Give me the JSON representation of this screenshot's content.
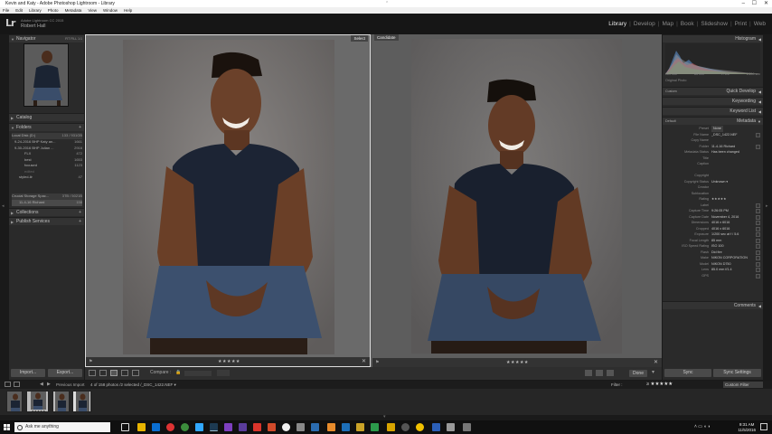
{
  "window": {
    "title": "Kevin and Katy - Adobe Photoshop Lightroom - Library"
  },
  "menu": [
    "File",
    "Edit",
    "Library",
    "Photo",
    "Metadata",
    "View",
    "Window",
    "Help"
  ],
  "identity": {
    "logo": "Lr",
    "version": "Adobe Lightroom CC 2015",
    "user": "Robert Hall"
  },
  "modules": [
    {
      "label": "Library",
      "active": true
    },
    {
      "label": "Develop"
    },
    {
      "label": "Map"
    },
    {
      "label": "Book"
    },
    {
      "label": "Slideshow"
    },
    {
      "label": "Print"
    },
    {
      "label": "Web"
    }
  ],
  "left": {
    "navigator": {
      "title": "Navigator",
      "zoom": "FIT  FILL  1:1"
    },
    "catalog": "Catalog",
    "folders": "Folders",
    "volume1": {
      "name": "Local Disk (D:)",
      "info": "133 / 931GB"
    },
    "folder_rows": [
      {
        "name": "9-24-2016 BHP Katy an...",
        "count": "1661"
      },
      {
        "name": "9-30-2016 BHP Julian ...",
        "count": "2916"
      },
      {
        "name": "FLX",
        "count": "472"
      },
      {
        "name": "best",
        "count": "1653"
      },
      {
        "name": "focused",
        "count": "1123"
      },
      {
        "name": "edited",
        "count": ""
      },
      {
        "name": "styled-ilr",
        "count": "47"
      }
    ],
    "volume2": {
      "name": "Crucial Storage Spac...",
      "info": "3TB / 5021B"
    },
    "volume2_rows": [
      {
        "name": "11-4-16 Richard",
        "count": "158"
      }
    ],
    "collections": "Collections",
    "publish": "Publish Services",
    "import_label": "Import...",
    "export_label": "Export..."
  },
  "center": {
    "select_tag": "Select",
    "candidate_tag": "Candidate",
    "rating": "★★★★★",
    "compare_label": "Compare :",
    "done_label": "Done"
  },
  "right": {
    "histogram": "Histogram",
    "hist_meta": [
      "ISO 100",
      "85 mm",
      "f / 5.6",
      "1/200 sec"
    ],
    "original_photo": "Original Photo",
    "quick_develop": "Quick Develop",
    "custom_preset": "Custom",
    "keywording": "Keywording",
    "keyword_list": "Keyword List",
    "metadata": "Metadata",
    "default_preset": "Default",
    "rows": [
      {
        "k": "Preset",
        "v": "None",
        "field": true
      },
      {
        "k": "File Name",
        "v": "_DSC_1422.NEF",
        "chk": true
      },
      {
        "k": "Copy Name",
        "v": ""
      },
      {
        "k": "Folder",
        "v": "11-4-16 Richard",
        "chk": true
      },
      {
        "k": "Metadata Status",
        "v": "Has been changed"
      },
      {
        "k": "Title",
        "v": ""
      },
      {
        "k": "Caption",
        "v": ""
      },
      {
        "k": "",
        "v": ""
      },
      {
        "k": "Copyright",
        "v": ""
      },
      {
        "k": "Copyright Status",
        "v": "Unknown ▾"
      },
      {
        "k": "Creator",
        "v": ""
      },
      {
        "k": "Sublocation",
        "v": ""
      },
      {
        "k": "Rating",
        "v": "★★★★★"
      },
      {
        "k": "Label",
        "v": "",
        "chk": true
      },
      {
        "k": "Capture Time",
        "v": "9:26:05 PM",
        "chk": true
      },
      {
        "k": "Capture Date",
        "v": "November 4, 2016",
        "chk": true
      },
      {
        "k": "Dimensions",
        "v": "4016 x 6016",
        "chk": true
      },
      {
        "k": "Cropped",
        "v": "4016 x 6016",
        "chk": true
      },
      {
        "k": "Exposure",
        "v": "1/200 sec at f / 5.6",
        "chk": true
      },
      {
        "k": "Focal Length",
        "v": "85 mm",
        "chk": true
      },
      {
        "k": "ISO Speed Rating",
        "v": "ISO 100",
        "chk": true
      },
      {
        "k": "Flash",
        "v": "Did fire",
        "chk": true
      },
      {
        "k": "Make",
        "v": "NIKON CORPORATION",
        "chk": true
      },
      {
        "k": "Model",
        "v": "NIKON D750",
        "chk": true
      },
      {
        "k": "Lens",
        "v": "85.0 mm f/1.4",
        "chk": true
      },
      {
        "k": "GPS",
        "v": "",
        "chk": true
      }
    ],
    "comments": "Comments",
    "sync_label": "Sync",
    "sync_settings_label": "Sync Settings"
  },
  "filmbar": {
    "source": "Previous Import",
    "info": "4 of 158 photos /2 selected /_DSC_1422.NEF ▾",
    "filter_label": "Filter :",
    "filter_stars": "≥ ★★★★★",
    "custom_filter": "Custom Filter"
  },
  "taskbar": {
    "search_placeholder": "Ask me anything",
    "time": "9:31 AM",
    "date": "11/5/2016"
  },
  "colors": {
    "accent": "#e6e6e6",
    "panel": "#2a2a2a",
    "taskbar_blue": "#0078d7"
  }
}
